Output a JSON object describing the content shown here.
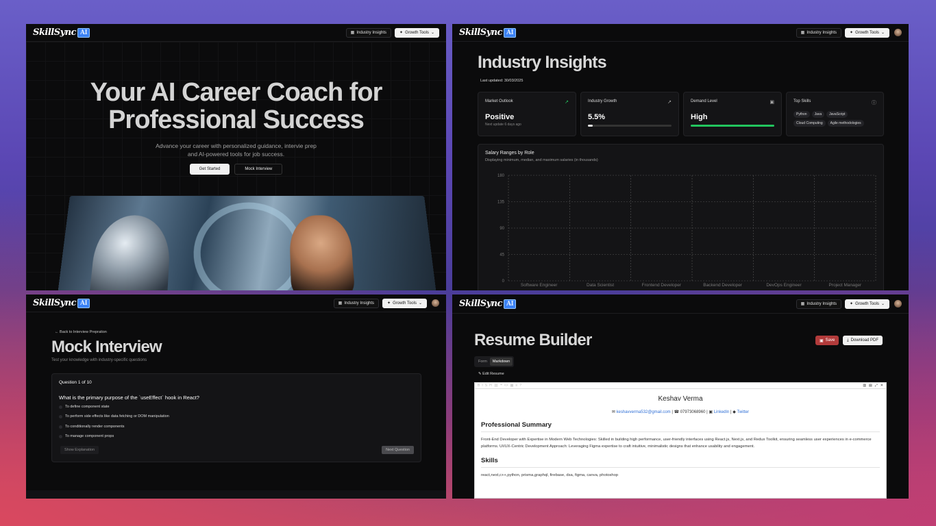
{
  "brand": {
    "name": "SkillSync",
    "ai": "AI"
  },
  "nav": {
    "industry_insights": "Industry Insights",
    "growth_tools": "Growth Tools"
  },
  "landing": {
    "title_line1": "Your AI Career Coach for",
    "title_line2": "Professional Success",
    "subtitle_line1": "Advance your career with personalized guidance, intervie prep",
    "subtitle_line2": "and AI-powered tools for job success.",
    "get_started": "Get Started",
    "mock_interview": "Mock Interview"
  },
  "insights": {
    "title": "Industry Insights",
    "last_updated": "Last updated: 30/03/2025",
    "cards": [
      {
        "label": "Market Outlook",
        "value": "Positive",
        "sub": "Next update 6 days ago",
        "icon": "trending-up-icon"
      },
      {
        "label": "Industry Growth",
        "value": "5.5%",
        "progress": 0.055,
        "icon": "trending-up-icon"
      },
      {
        "label": "Demand Level",
        "value": "High",
        "progress": 1.0,
        "icon": "briefcase-icon"
      },
      {
        "label": "Top Skills",
        "icon": "info-icon",
        "skills": [
          "Python",
          "Java",
          "JavaScript",
          "Cloud Computing",
          "Agile methodologies"
        ]
      }
    ],
    "chart_title": "Salary Ranges by Role",
    "chart_subtitle": "Displaying minimum, median, and maximum salaries (in thousands)"
  },
  "chart_data": {
    "type": "bar",
    "title": "Salary Ranges by Role",
    "subtitle": "Displaying minimum, median, and maximum salaries (in thousands)",
    "categories": [
      "Software Engineer",
      "Data Scientist",
      "Frontend Developer",
      "Backend Developer",
      "DevOps Engineer",
      "Project Manager"
    ],
    "yticks": [
      "0",
      "45",
      "90",
      "135",
      "180"
    ],
    "ylim": [
      0,
      180
    ],
    "grid": true,
    "series": []
  },
  "mock": {
    "back": "Back to Interview Prepration",
    "title": "Mock Interview",
    "subtitle": "Test your knowledge with industry-specific questions",
    "question_number": "Question 1 of 10",
    "question": "What is the primary purpose of the `useEffect` hook in React?",
    "options": [
      "To define component state",
      "To perform side effects like data fetching or DOM manipulation",
      "To conditionally render components",
      "To manage component props"
    ],
    "show_explanation": "Show Explanation",
    "next_question": "Next Question"
  },
  "resume": {
    "title": "Resume Builder",
    "save": "Save",
    "download": "Download PDF",
    "tab_form": "Form",
    "tab_markdown": "Markdown",
    "edit_resume": "Edit Resume",
    "name": "Keshav Verma",
    "email": "keshavverma532@gmail.com",
    "phone": "07973068960",
    "linkedin": "LinkedIn",
    "twitter": "Twitter",
    "summary_heading": "Professional Summary",
    "summary": "Front-End Developer with Expertise in Modern Web Technologies: Skilled in building high performance, user-friendly interfaces using React.js, Next.js, and Redux Toolkit, ensuring seamless user experiences in e-commerce platforms. UI/UX-Centric Development Approach: Leveraging Figma expertise to craft intuitive, minimalistic designs that enhance usability and engagement.",
    "skills_heading": "Skills",
    "skills": "react,next,c++,python, prisma,graphql, firebase, dsa, figma, canva, photoshop"
  },
  "colors": {
    "accent": "#3b82f6",
    "progress": "#22c55e",
    "save": "#b23b3b"
  }
}
